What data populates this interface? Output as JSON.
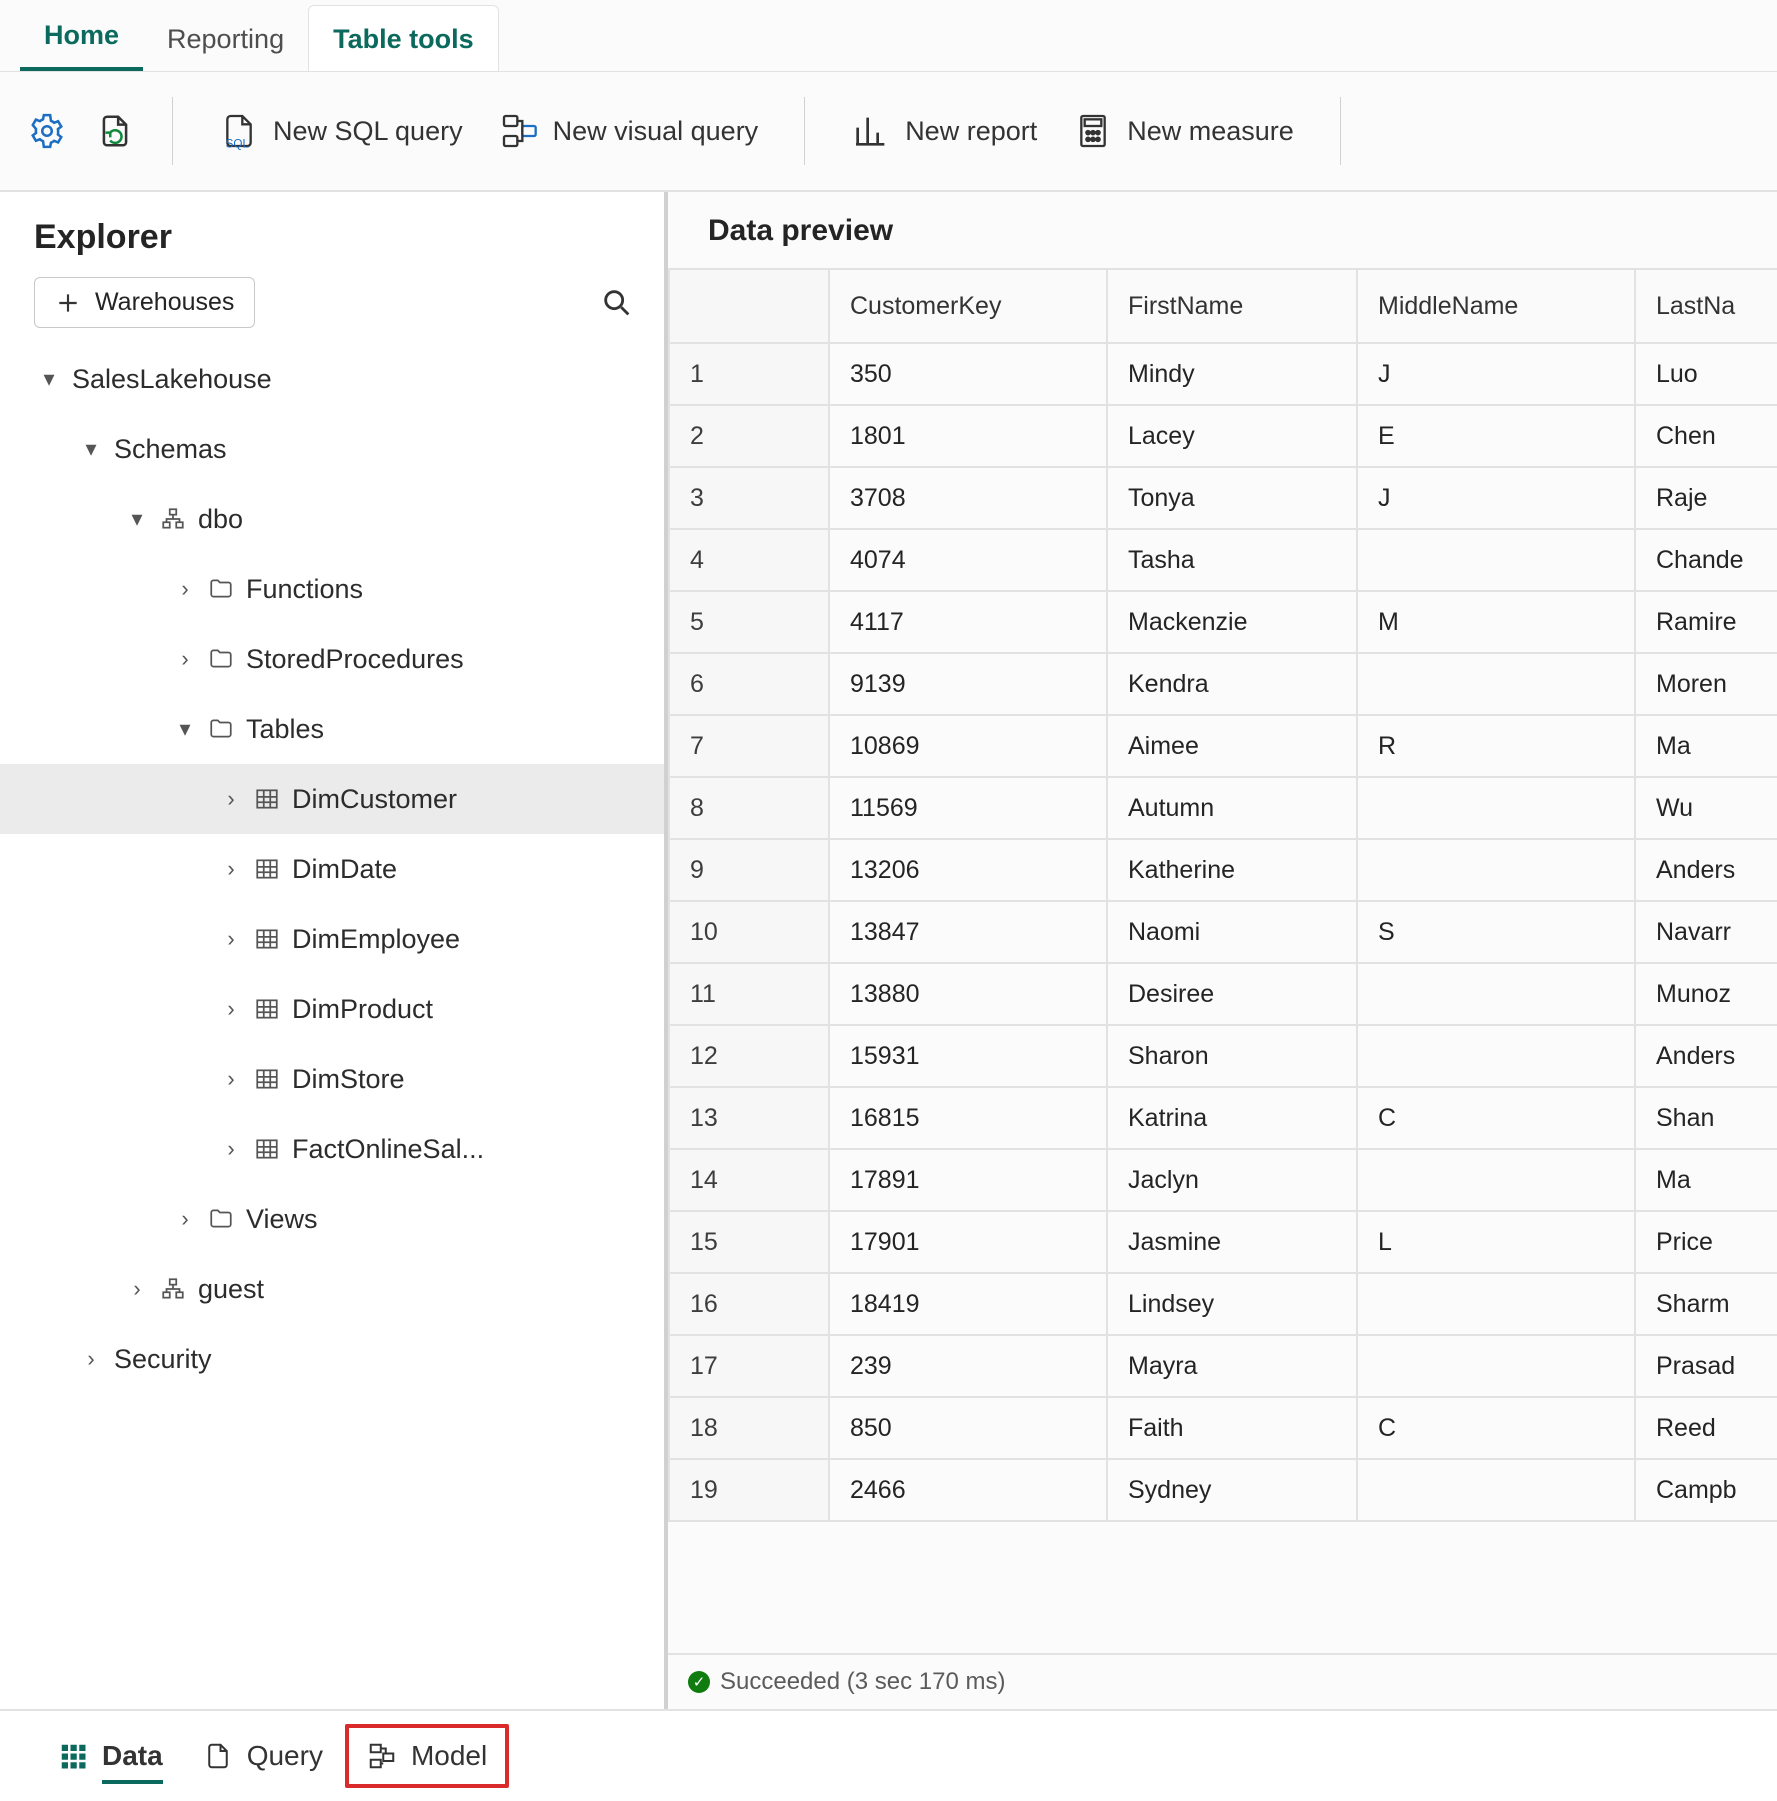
{
  "tabs": {
    "home": "Home",
    "reporting": "Reporting",
    "tabletools": "Table tools"
  },
  "ribbon": {
    "newSql": "New SQL query",
    "newVisual": "New visual query",
    "newReport": "New report",
    "newMeasure": "New measure"
  },
  "explorer": {
    "title": "Explorer",
    "warehouses": "Warehouses",
    "root": "SalesLakehouse",
    "schemas": "Schemas",
    "dbo": "dbo",
    "functions": "Functions",
    "sprocs": "StoredProcedures",
    "tables": "Tables",
    "tbl": {
      "dimCustomer": "DimCustomer",
      "dimDate": "DimDate",
      "dimEmployee": "DimEmployee",
      "dimProduct": "DimProduct",
      "dimStore": "DimStore",
      "factOnline": "FactOnlineSal..."
    },
    "views": "Views",
    "guest": "guest",
    "security": "Security"
  },
  "preview": {
    "title": "Data preview",
    "cols": [
      "",
      "CustomerKey",
      "FirstName",
      "MiddleName",
      "LastNa"
    ],
    "rows": [
      {
        "n": "1",
        "k": "350",
        "f": "Mindy",
        "m": "J",
        "l": "Luo"
      },
      {
        "n": "2",
        "k": "1801",
        "f": "Lacey",
        "m": "E",
        "l": "Chen"
      },
      {
        "n": "3",
        "k": "3708",
        "f": "Tonya",
        "m": "J",
        "l": "Raje"
      },
      {
        "n": "4",
        "k": "4074",
        "f": "Tasha",
        "m": "",
        "l": "Chande"
      },
      {
        "n": "5",
        "k": "4117",
        "f": "Mackenzie",
        "m": "M",
        "l": "Ramire"
      },
      {
        "n": "6",
        "k": "9139",
        "f": "Kendra",
        "m": "",
        "l": "Moren"
      },
      {
        "n": "7",
        "k": "10869",
        "f": "Aimee",
        "m": "R",
        "l": "Ma"
      },
      {
        "n": "8",
        "k": "11569",
        "f": "Autumn",
        "m": "",
        "l": "Wu"
      },
      {
        "n": "9",
        "k": "13206",
        "f": "Katherine",
        "m": "",
        "l": "Anders"
      },
      {
        "n": "10",
        "k": "13847",
        "f": "Naomi",
        "m": "S",
        "l": "Navarr"
      },
      {
        "n": "11",
        "k": "13880",
        "f": "Desiree",
        "m": "",
        "l": "Munoz"
      },
      {
        "n": "12",
        "k": "15931",
        "f": "Sharon",
        "m": "",
        "l": "Anders"
      },
      {
        "n": "13",
        "k": "16815",
        "f": "Katrina",
        "m": "C",
        "l": "Shan"
      },
      {
        "n": "14",
        "k": "17891",
        "f": "Jaclyn",
        "m": "",
        "l": "Ma"
      },
      {
        "n": "15",
        "k": "17901",
        "f": "Jasmine",
        "m": "L",
        "l": "Price"
      },
      {
        "n": "16",
        "k": "18419",
        "f": "Lindsey",
        "m": "",
        "l": "Sharm"
      },
      {
        "n": "17",
        "k": "239",
        "f": "Mayra",
        "m": "",
        "l": "Prasad"
      },
      {
        "n": "18",
        "k": "850",
        "f": "Faith",
        "m": "C",
        "l": "Reed"
      },
      {
        "n": "19",
        "k": "2466",
        "f": "Sydney",
        "m": "",
        "l": "Campb"
      }
    ],
    "status": "Succeeded (3 sec 170 ms)"
  },
  "footer": {
    "data": "Data",
    "query": "Query",
    "model": "Model"
  }
}
